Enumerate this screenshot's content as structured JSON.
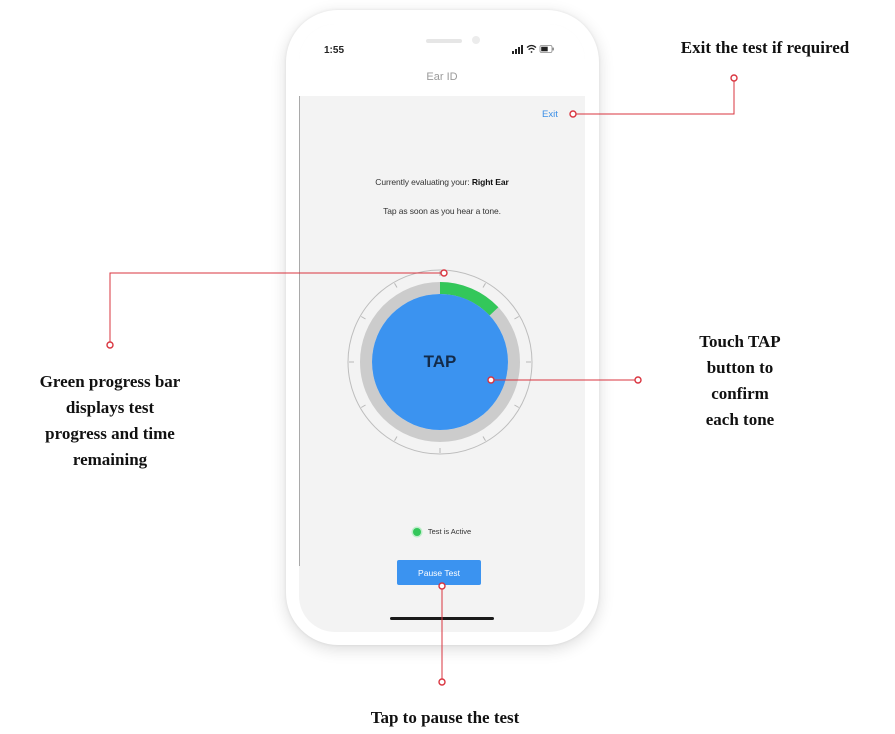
{
  "status_bar": {
    "time": "1:55"
  },
  "nav": {
    "title": "Ear ID"
  },
  "exit_label": "Exit",
  "evaluation": {
    "prefix": "Currently evaluating your: ",
    "ear": "Right Ear"
  },
  "instruction": "Tap as soon as you hear a tone.",
  "progress": {
    "fraction": 0.13,
    "color": "#33c75a"
  },
  "tap_label": "TAP",
  "status_text": "Test is Active",
  "pause_label": "Pause Test",
  "annotations": {
    "exit": "Exit the test if required",
    "progress": [
      "Green progress bar",
      "displays test",
      "progress and time",
      "remaining"
    ],
    "tap": [
      "Touch TAP",
      "button to",
      "confirm",
      "each tone"
    ],
    "pause": "Tap to pause the test"
  },
  "colors": {
    "accent": "#3b93f0",
    "callout": "#d9343f",
    "active": "#33c75a",
    "exit_link": "#3a8ee6"
  }
}
